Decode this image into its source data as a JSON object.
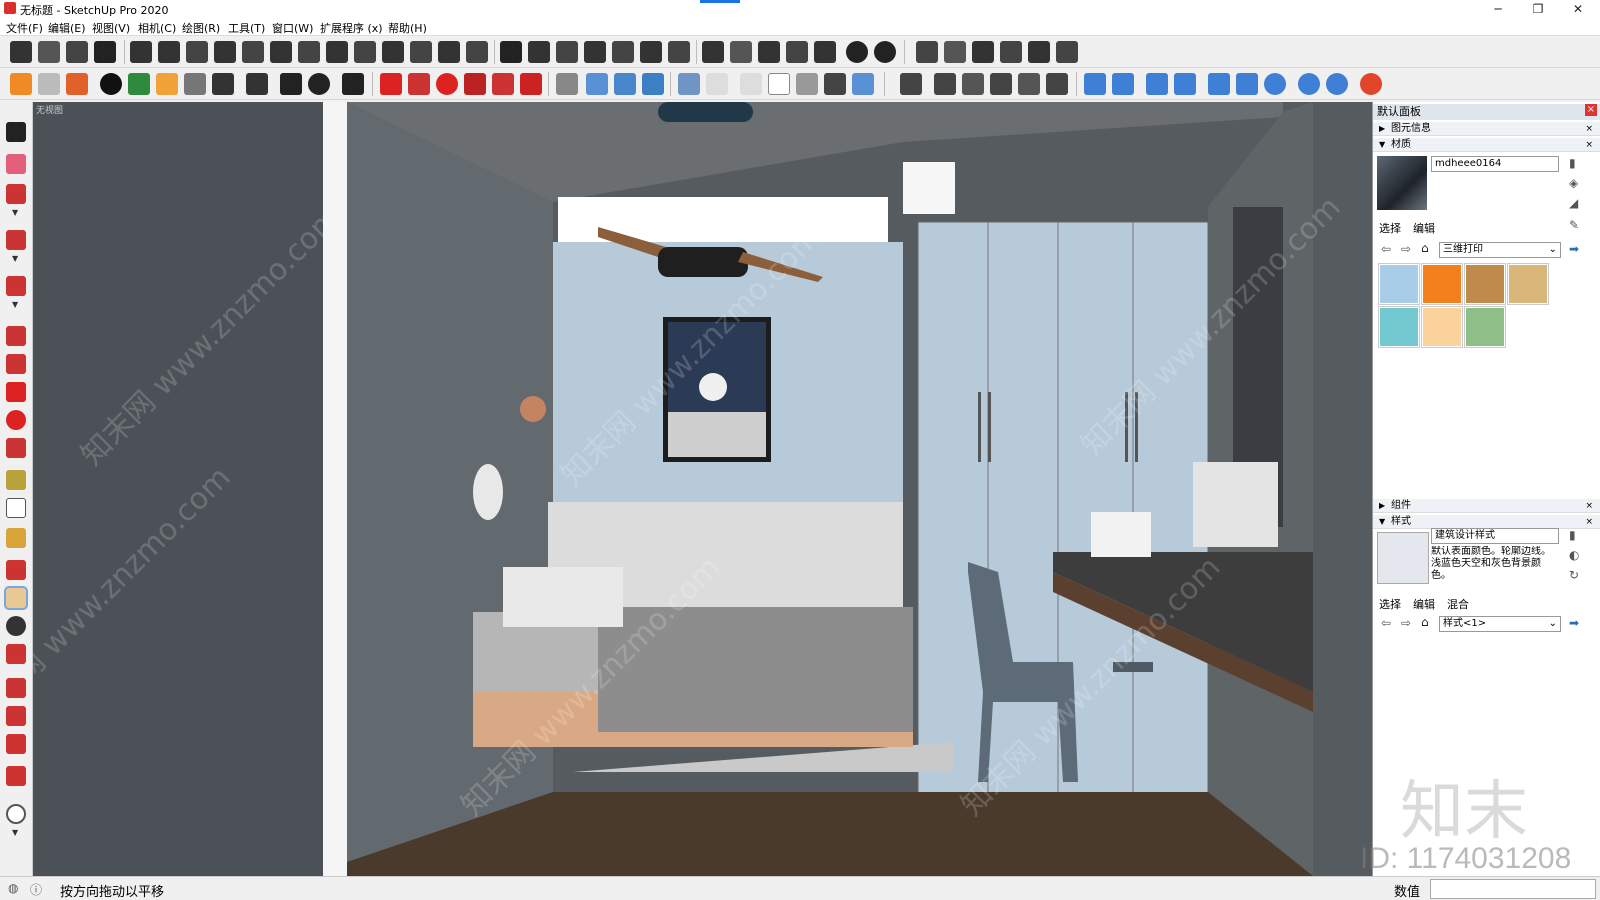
{
  "window": {
    "title": "无标题 - SketchUp Pro 2020",
    "minimize": "─",
    "maximize": "❐",
    "close": "✕"
  },
  "menu": [
    "文件(F)",
    "编辑(E)",
    "视图(V)",
    "相机(C)",
    "绘图(R)",
    "工具(T)",
    "窗口(W)",
    "扩展程序 (x)",
    "帮助(H)"
  ],
  "viewport": {
    "scene_label": "无视图"
  },
  "panel": {
    "title": "默认面板",
    "close": "×",
    "entity_info": {
      "label": "图元信息"
    },
    "materials": {
      "label": "材质",
      "material_name": "mdheee0164",
      "tabs": [
        "选择",
        "编辑"
      ],
      "library": "三维打印",
      "swatches": [
        "#a7cde9",
        "#f4801d",
        "#c08a4b",
        "#d9b77a",
        "#72c9cf",
        "#fcd29c",
        "#8fbf88"
      ]
    },
    "components": {
      "label": "组件"
    },
    "styles": {
      "label": "样式",
      "style_name": "建筑设计样式",
      "description": "默认表面颜色。轮廓边线。浅蓝色天空和灰色背景颜色。",
      "tabs": [
        "选择",
        "编辑",
        "混合"
      ],
      "style_select": "样式<1>"
    }
  },
  "status": {
    "hint": "按方向拖动以平移",
    "value_label": "数值"
  },
  "watermark": {
    "site": "知末网 www.znzmo.com",
    "brand": "知末",
    "id": "ID: 1174031208"
  }
}
